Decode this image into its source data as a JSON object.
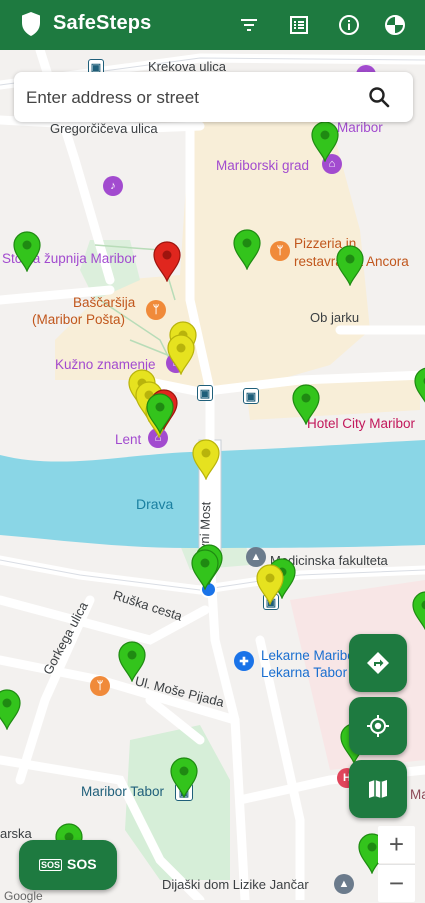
{
  "app": {
    "title": "SafeSteps"
  },
  "toolbar": {
    "filter_icon": "filter-icon",
    "list_icon": "list-icon",
    "info_icon": "info-icon",
    "stats_icon": "pie-chart-icon"
  },
  "search": {
    "placeholder": "Enter address or street",
    "icon": "search-icon"
  },
  "map_labels": {
    "krekova": "Krekova ulica",
    "gregorciceva": "Gregorčičeva ulica",
    "mariborski_grad": "Mariborski grad",
    "maribor_top": "Maribor",
    "stolna": "Stolna župnija Maribor",
    "pizzeria_1": "Pizzeria in",
    "pizzeria_2": "restavracija Ancora",
    "bascarsija_1": "Baščaršija",
    "bascarsija_2": "(Maribor Pošta)",
    "ob_jarku": "Ob jarku",
    "kuzno": "Kužno znamenje",
    "hotel": "Hotel City Maribor",
    "lent": "Lent",
    "drava": "Drava",
    "glavni_most": "Glavni Most",
    "medicinska": "Medicinska fakulteta",
    "ruska": "Ruška cesta",
    "gorkega": "Gorkega ulica",
    "lekarne_1": "Lekarne Maribor",
    "lekarne_2": "Lekarna Tabor",
    "mose_pijade": "Ul. Moše Pijada",
    "tabor": "Maribor Tabor",
    "dijaski": "Dijaški dom Lizike Jančar",
    "arska": "arska",
    "right_m": "Ma"
  },
  "fabs": {
    "directions_icon": "directions-icon",
    "locate_icon": "my-location-icon",
    "map_icon": "map-icon"
  },
  "zoom": {
    "in": "+",
    "out": "−"
  },
  "sos": {
    "icon_text": "SOS",
    "label": "SOS"
  },
  "attribution": "Google",
  "colors": {
    "primary": "#1e7a40",
    "pin_green": "#33c41c",
    "pin_yellow": "#e6e21f",
    "pin_red": "#e0261e",
    "water": "#8ad6e6"
  },
  "markers": [
    {
      "color": "green"
    },
    {
      "color": "green"
    },
    {
      "color": "green"
    },
    {
      "color": "green"
    },
    {
      "color": "red"
    },
    {
      "color": "yellow"
    },
    {
      "color": "yellow"
    },
    {
      "color": "yellow"
    },
    {
      "color": "yellow"
    },
    {
      "color": "yellow"
    },
    {
      "color": "red"
    },
    {
      "color": "green"
    },
    {
      "color": "green"
    },
    {
      "color": "yellow"
    },
    {
      "color": "green"
    },
    {
      "color": "green"
    },
    {
      "color": "green"
    },
    {
      "color": "green"
    },
    {
      "color": "yellow"
    },
    {
      "color": "green"
    },
    {
      "color": "green"
    },
    {
      "color": "green"
    },
    {
      "color": "green"
    },
    {
      "color": "green"
    },
    {
      "color": "green"
    },
    {
      "color": "green"
    }
  ]
}
